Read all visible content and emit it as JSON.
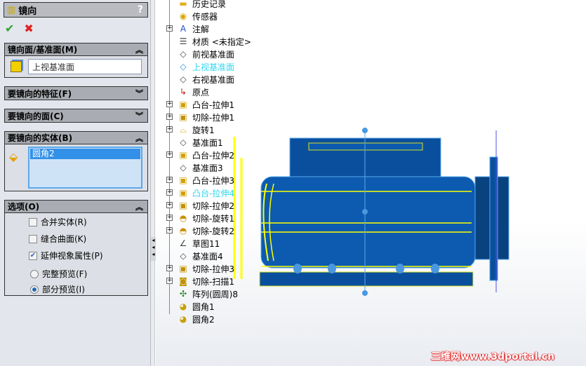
{
  "panel": {
    "title": "镜向",
    "help": "?",
    "ok": "✔",
    "cancel": "✖",
    "mirror_plane": {
      "header": "镜向面/基准面(M)",
      "value": "上视基准面"
    },
    "features": {
      "header": "要镜向的特征(F)"
    },
    "faces": {
      "header": "要镜向的面(C)"
    },
    "bodies": {
      "header": "要镜向的实体(B)",
      "items": [
        "圆角2"
      ]
    },
    "options": {
      "header": "选项(O)",
      "merge": "合并实体(R)",
      "knit": "缝合曲面(K)",
      "propagate": "延伸视象属性(P)",
      "full_preview": "完整预览(F)",
      "partial_preview": "部分预览(I)",
      "merge_checked": false,
      "knit_checked": false,
      "propagate_checked": true,
      "preview_mode": "partial"
    }
  },
  "tree": {
    "items": [
      {
        "label": "历史记录",
        "icon": "folder-icon"
      },
      {
        "label": "传感器",
        "icon": "sensor-folder-icon"
      },
      {
        "label": "注解",
        "icon": "annotation-folder-icon"
      },
      {
        "label": "材质 <未指定>",
        "icon": "material-icon"
      },
      {
        "label": "前视基准面",
        "icon": "plane-icon"
      },
      {
        "label": "上视基准面",
        "icon": "plane-icon",
        "selected": true
      },
      {
        "label": "右视基准面",
        "icon": "plane-icon"
      },
      {
        "label": "原点",
        "icon": "origin-icon"
      },
      {
        "label": "凸台-拉伸1",
        "icon": "boss-extrude-icon"
      },
      {
        "label": "切除-拉伸1",
        "icon": "cut-extrude-icon"
      },
      {
        "label": "旋转1",
        "icon": "revolve-icon"
      },
      {
        "label": "基准面1",
        "icon": "plane-icon"
      },
      {
        "label": "凸台-拉伸2",
        "icon": "boss-extrude-icon"
      },
      {
        "label": "基准面3",
        "icon": "plane-icon"
      },
      {
        "label": "凸台-拉伸3",
        "icon": "boss-extrude-icon"
      },
      {
        "label": "凸台-拉伸4",
        "icon": "boss-extrude-icon",
        "selected": true
      },
      {
        "label": "切除-拉伸2",
        "icon": "cut-extrude-icon"
      },
      {
        "label": "切除-旋转1",
        "icon": "cut-revolve-icon"
      },
      {
        "label": "切除-旋转2",
        "icon": "cut-revolve-icon"
      },
      {
        "label": "草图11",
        "icon": "sketch-icon"
      },
      {
        "label": "基准面4",
        "icon": "plane-icon"
      },
      {
        "label": "切除-拉伸3",
        "icon": "cut-extrude-icon"
      },
      {
        "label": "切除-扫描1",
        "icon": "cut-sweep-icon"
      },
      {
        "label": "阵列(圆周)8",
        "icon": "circular-pattern-icon"
      },
      {
        "label": "圆角1",
        "icon": "fillet-icon"
      },
      {
        "label": "圆角2",
        "icon": "fillet-icon"
      }
    ]
  },
  "watermark": "三维网www.3dportal.cn",
  "colors": {
    "model": "#0a4f9e",
    "edge": "#5aa8ee",
    "highlight": "#ffff00",
    "selected_text": "#2fd7f0"
  }
}
